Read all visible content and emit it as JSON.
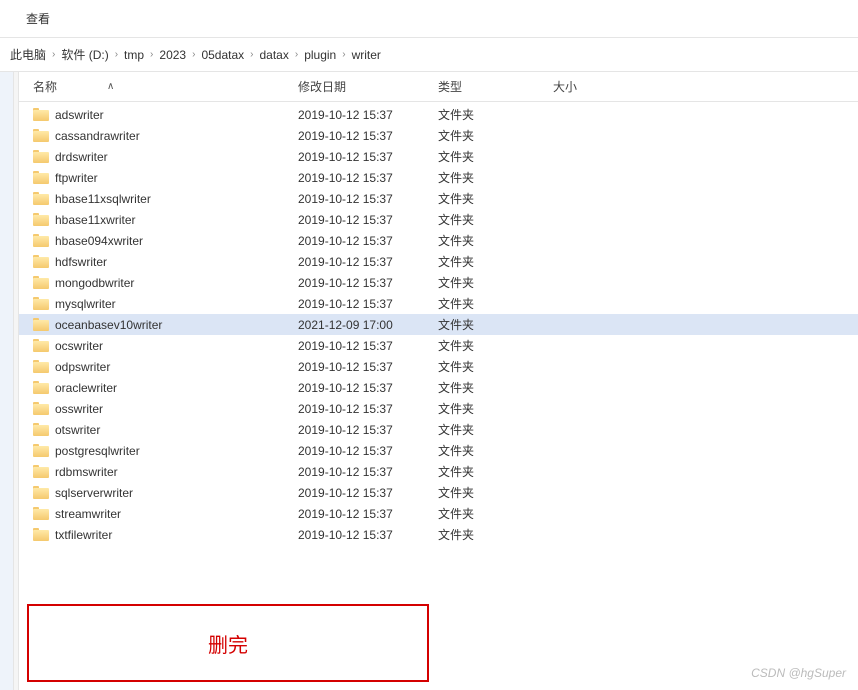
{
  "menu": {
    "view": "查看"
  },
  "breadcrumb": {
    "items": [
      "此电脑",
      "软件 (D:)",
      "tmp",
      "2023",
      "05datax",
      "datax",
      "plugin",
      "writer"
    ]
  },
  "columns": {
    "name": "名称",
    "date": "修改日期",
    "type": "类型",
    "size": "大小"
  },
  "files": [
    {
      "name": "adswriter",
      "date": "2019-10-12 15:37",
      "type": "文件夹",
      "selected": false
    },
    {
      "name": "cassandrawriter",
      "date": "2019-10-12 15:37",
      "type": "文件夹",
      "selected": false
    },
    {
      "name": "drdswriter",
      "date": "2019-10-12 15:37",
      "type": "文件夹",
      "selected": false
    },
    {
      "name": "ftpwriter",
      "date": "2019-10-12 15:37",
      "type": "文件夹",
      "selected": false
    },
    {
      "name": "hbase11xsqlwriter",
      "date": "2019-10-12 15:37",
      "type": "文件夹",
      "selected": false
    },
    {
      "name": "hbase11xwriter",
      "date": "2019-10-12 15:37",
      "type": "文件夹",
      "selected": false
    },
    {
      "name": "hbase094xwriter",
      "date": "2019-10-12 15:37",
      "type": "文件夹",
      "selected": false
    },
    {
      "name": "hdfswriter",
      "date": "2019-10-12 15:37",
      "type": "文件夹",
      "selected": false
    },
    {
      "name": "mongodbwriter",
      "date": "2019-10-12 15:37",
      "type": "文件夹",
      "selected": false
    },
    {
      "name": "mysqlwriter",
      "date": "2019-10-12 15:37",
      "type": "文件夹",
      "selected": false
    },
    {
      "name": "oceanbasev10writer",
      "date": "2021-12-09 17:00",
      "type": "文件夹",
      "selected": true
    },
    {
      "name": "ocswriter",
      "date": "2019-10-12 15:37",
      "type": "文件夹",
      "selected": false
    },
    {
      "name": "odpswriter",
      "date": "2019-10-12 15:37",
      "type": "文件夹",
      "selected": false
    },
    {
      "name": "oraclewriter",
      "date": "2019-10-12 15:37",
      "type": "文件夹",
      "selected": false
    },
    {
      "name": "osswriter",
      "date": "2019-10-12 15:37",
      "type": "文件夹",
      "selected": false
    },
    {
      "name": "otswriter",
      "date": "2019-10-12 15:37",
      "type": "文件夹",
      "selected": false
    },
    {
      "name": "postgresqlwriter",
      "date": "2019-10-12 15:37",
      "type": "文件夹",
      "selected": false
    },
    {
      "name": "rdbmswriter",
      "date": "2019-10-12 15:37",
      "type": "文件夹",
      "selected": false
    },
    {
      "name": "sqlserverwriter",
      "date": "2019-10-12 15:37",
      "type": "文件夹",
      "selected": false
    },
    {
      "name": "streamwriter",
      "date": "2019-10-12 15:37",
      "type": "文件夹",
      "selected": false
    },
    {
      "name": "txtfilewriter",
      "date": "2019-10-12 15:37",
      "type": "文件夹",
      "selected": false
    }
  ],
  "annotation": {
    "text": "删完"
  },
  "watermark": "CSDN @hgSuper"
}
